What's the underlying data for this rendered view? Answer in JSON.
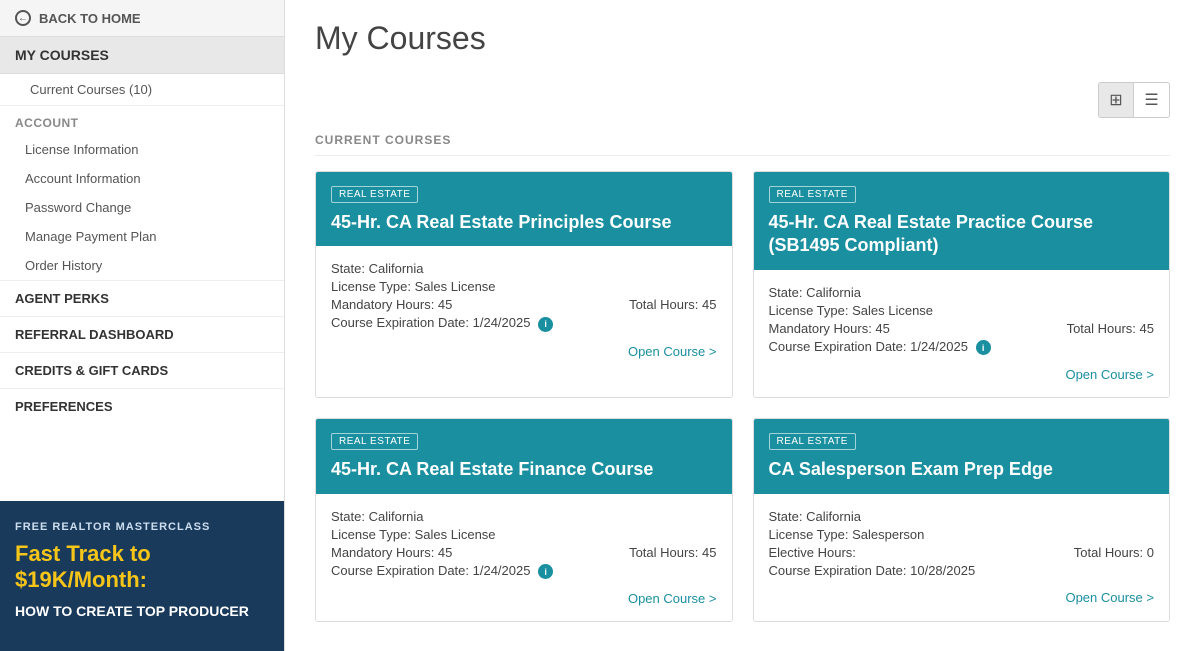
{
  "sidebar": {
    "back_label": "BACK TO HOME",
    "mycourses_label": "MY COURSES",
    "submenu": {
      "current_courses": "Current Courses (10)"
    },
    "account": {
      "title": "ACCOUNT",
      "items": [
        "License Information",
        "Account Information",
        "Password Change",
        "Manage Payment Plan",
        "Order History"
      ]
    },
    "nav_items": [
      "AGENT PERKS",
      "REFERRAL DASHBOARD",
      "CREDITS & GIFT CARDS",
      "PREFERENCES"
    ]
  },
  "banner": {
    "subtitle": "FREE REALTOR MASTERCLASS",
    "title": "Fast Track to $19K/Month:",
    "desc": "HOW TO CREATE TOP PRODUCER"
  },
  "main": {
    "page_title": "My Courses",
    "section_label": "CURRENT COURSES",
    "view_toggle_grid": "⊞",
    "view_toggle_list": "☰",
    "courses": [
      {
        "tag": "REAL ESTATE",
        "title": "45-Hr. CA Real Estate Principles Course",
        "state": "California",
        "license_type": "Sales License",
        "mandatory_hours": "45",
        "total_hours": "45",
        "expiration": "1/24/2025",
        "elective_hours": null,
        "open_label": "Open Course >"
      },
      {
        "tag": "REAL ESTATE",
        "title": "45-Hr. CA Real Estate Practice Course (SB1495 Compliant)",
        "state": "California",
        "license_type": "Sales License",
        "mandatory_hours": "45",
        "total_hours": "45",
        "expiration": "1/24/2025",
        "elective_hours": null,
        "open_label": "Open Course >"
      },
      {
        "tag": "REAL ESTATE",
        "title": "45-Hr. CA Real Estate Finance Course",
        "state": "California",
        "license_type": "Sales License",
        "mandatory_hours": "45",
        "total_hours": "45",
        "expiration": "1/24/2025",
        "elective_hours": null,
        "open_label": "Open Course >"
      },
      {
        "tag": "REAL ESTATE",
        "title": "CA Salesperson Exam Prep Edge",
        "state": "California",
        "license_type": "Salesperson",
        "mandatory_hours": null,
        "total_hours": "0",
        "expiration": "10/28/2025",
        "elective_hours": "",
        "open_label": "Open Course >"
      }
    ]
  }
}
